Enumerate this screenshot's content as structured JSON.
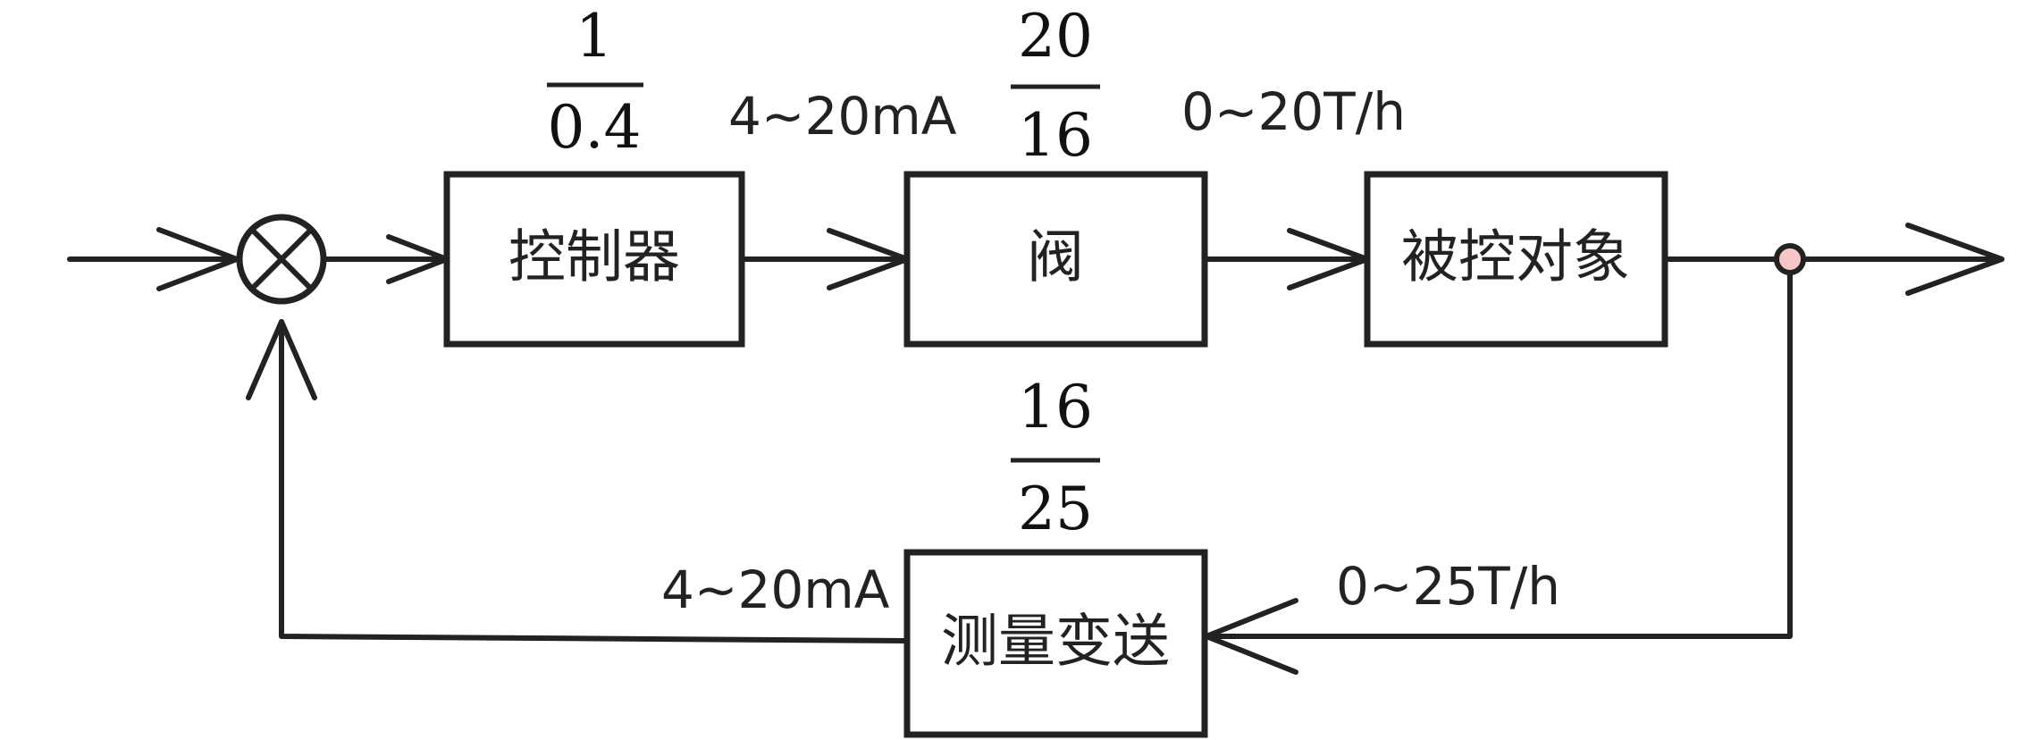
{
  "blocks": {
    "controller": "控制器",
    "valve": "阀",
    "plant": "被控对象",
    "transmitter": "测量变送"
  },
  "gains": {
    "controller": {
      "numerator": "1",
      "denominator": "0.4"
    },
    "valve": {
      "numerator": "20",
      "denominator": "16"
    },
    "transmitter": {
      "numerator": "16",
      "denominator": "25"
    }
  },
  "signals": {
    "controller_output": "4~20mA",
    "valve_output": "0~20T/h",
    "feedback_output": "4~20mA",
    "feedback_input": "0~25T/h"
  },
  "colors": {
    "line": "#222222",
    "branch_point": "#f7c6c6"
  }
}
